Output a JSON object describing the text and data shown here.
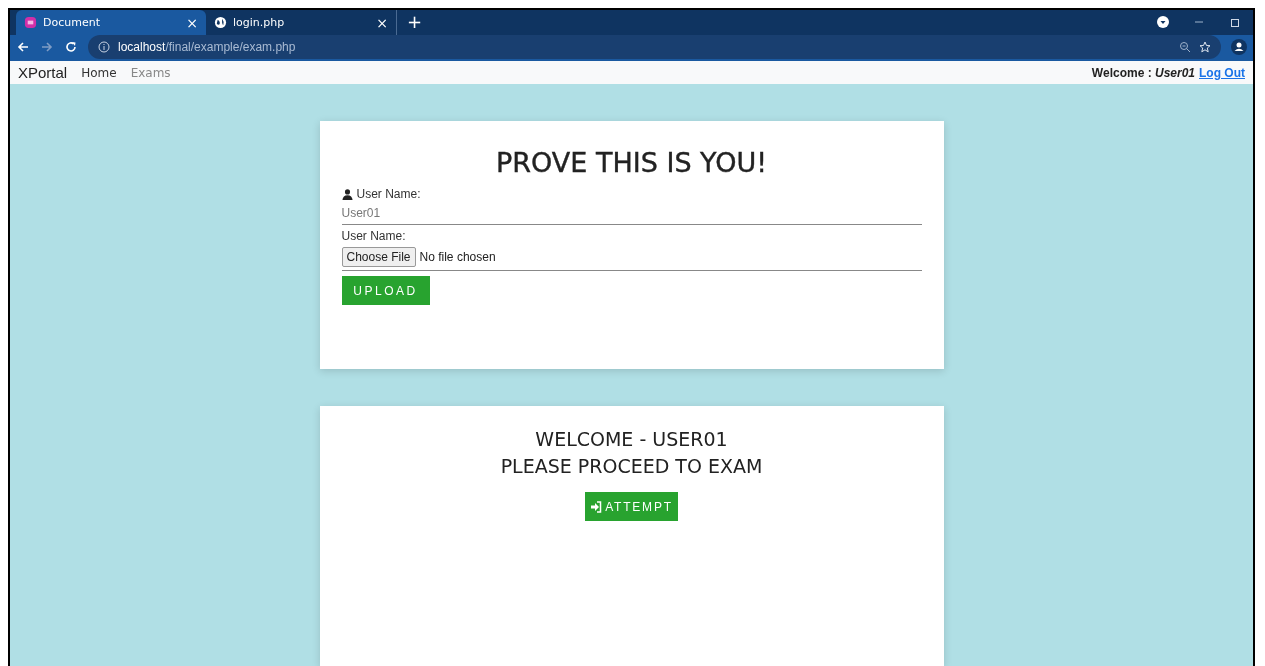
{
  "browser": {
    "tabs": [
      {
        "label": "Document",
        "selected": true,
        "close": "×"
      },
      {
        "label": "login.php",
        "selected": false,
        "close": "×"
      }
    ],
    "new_tab": "+",
    "address": {
      "host": "localhost",
      "path": "/final/example/exam.php"
    }
  },
  "navbar": {
    "brand": "XPortal",
    "links": [
      {
        "label": "Home",
        "selected": true
      },
      {
        "label": "Exams",
        "selected": false
      }
    ],
    "welcome": "Welcome : ",
    "user": "User01",
    "logout": "Log Out"
  },
  "verify_card": {
    "title": "PROVE THIS IS YOU!",
    "username_label": "User Name:",
    "username_value": "User01",
    "file_label": "User Name:",
    "file_button": "Choose File",
    "file_status": "No file chosen",
    "upload_button": "UPLOAD"
  },
  "exam_card": {
    "line_1": "WELCOME - USER01",
    "line_2": "PLEASE PROCEED TO EXAM",
    "attempt_button": "ATTEMPT"
  }
}
